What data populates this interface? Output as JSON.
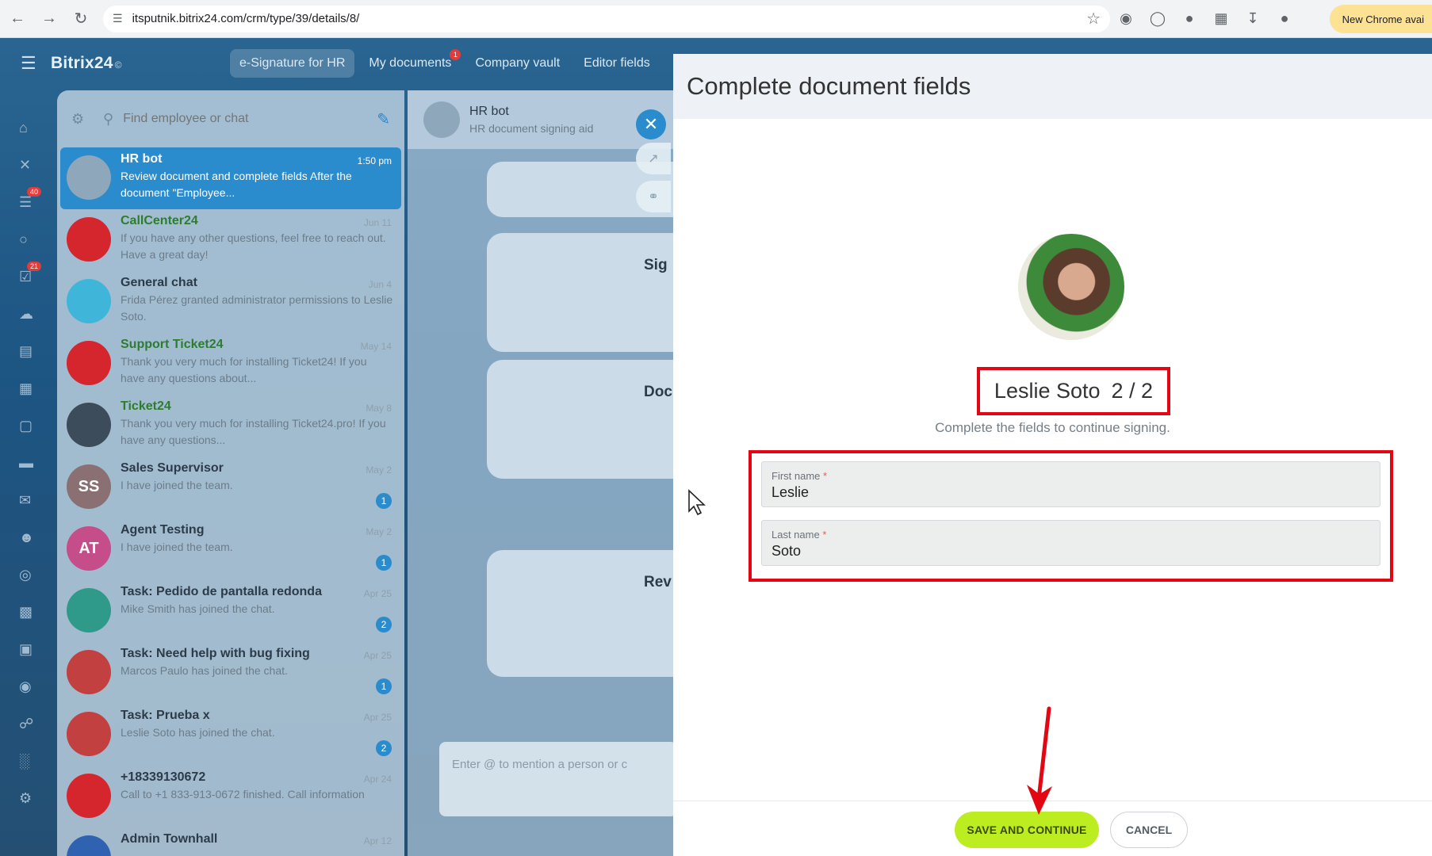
{
  "browser": {
    "url": "itsputnik.bitrix24.com/crm/type/39/details/8/",
    "new_chrome_label": "New Chrome avai"
  },
  "app": {
    "logo": "Bitrix24",
    "logo_mark": "©",
    "top_tabs": [
      {
        "label": "e-Signature for HR",
        "active": true
      },
      {
        "label": "My documents",
        "badge": "1"
      },
      {
        "label": "Company vault"
      },
      {
        "label": "Editor fields"
      }
    ],
    "sidebar_badges": {
      "feed": "40",
      "tasks": "21"
    }
  },
  "chat_list": {
    "search_placeholder": "Find employee or chat",
    "items": [
      {
        "name": "HR bot",
        "message": "Review document and complete fields After the document \"Employee...",
        "time": "1:50 pm",
        "active": true,
        "avatar": "bot-avatar",
        "color": "#8fa7ba"
      },
      {
        "name": "CallCenter24",
        "message": "If you have any other questions, feel free to reach out. Have a great day!",
        "time": "Jun 11",
        "avatar": "callcenter-avatar",
        "color": "#d6262d",
        "green": true
      },
      {
        "name": "General chat",
        "message": "Frida Pérez granted administrator permissions to Leslie Soto.",
        "time": "Jun 4",
        "avatar": "chat-bubble-avatar",
        "color": "#3fb6d9"
      },
      {
        "name": "Support Ticket24",
        "message": "Thank you very much for installing Ticket24! If you have any questions about...",
        "time": "May 14",
        "avatar": "tools-avatar",
        "color": "#d6262d",
        "green": true
      },
      {
        "name": "Ticket24",
        "message": "Thank you very much for installing Ticket24.pro! If you have any questions...",
        "time": "May 8",
        "avatar": "person-avatar",
        "color": "#3d4c5a",
        "green": true
      },
      {
        "name": "Sales Supervisor",
        "message": "I have joined the team.",
        "time": "May 2",
        "initials": "SS",
        "color": "#8a6f73",
        "count": "1"
      },
      {
        "name": "Agent Testing",
        "message": "I have joined the team.",
        "time": "May 2",
        "initials": "AT",
        "color": "#c44d8a",
        "count": "1"
      },
      {
        "name": "Task: Pedido de pantalla redonda",
        "message": "Mike Smith has joined the chat.",
        "time": "Apr 25",
        "avatar": "task-avatar",
        "color": "#2f9a8a",
        "count": "2"
      },
      {
        "name": "Task: Need help with bug fixing",
        "message": "Marcos Paulo has joined the chat.",
        "time": "Apr 25",
        "avatar": "task-avatar",
        "color": "#c24040",
        "count": "1"
      },
      {
        "name": "Task: Prueba x",
        "message": "Leslie Soto has joined the chat.",
        "time": "Apr 25",
        "avatar": "task-avatar",
        "color": "#c24040",
        "count": "2"
      },
      {
        "name": "+18339130672",
        "message": "Call to +1 833-913-0672 finished. Call information",
        "time": "Apr 24",
        "avatar": "phone-avatar",
        "color": "#d6262d"
      },
      {
        "name": "Admin Townhall",
        "message": "",
        "time": "Apr 12",
        "avatar": "group-avatar",
        "color": "#2f62b0"
      }
    ]
  },
  "conversation": {
    "title": "HR bot",
    "subtitle": "HR document signing aid",
    "cards": [
      {
        "heading": "Sig"
      },
      {
        "heading": "Doc"
      },
      {
        "heading": "Rev"
      }
    ],
    "input_placeholder": "Enter @ to mention a person or c"
  },
  "panel": {
    "title": "Complete document fields",
    "person_name": "Leslie Soto",
    "progress": "2 / 2",
    "hint": "Complete the fields to continue signing.",
    "fields": [
      {
        "label": "First name",
        "required_mark": "*",
        "value": "Leslie"
      },
      {
        "label": "Last name",
        "required_mark": "*",
        "value": "Soto"
      }
    ],
    "save_label": "SAVE AND CONTINUE",
    "cancel_label": "CANCEL"
  },
  "colors": {
    "accent_green": "#bbed21",
    "annotation_red": "#e30613",
    "bitrix_blue": "#2a8bcd"
  }
}
